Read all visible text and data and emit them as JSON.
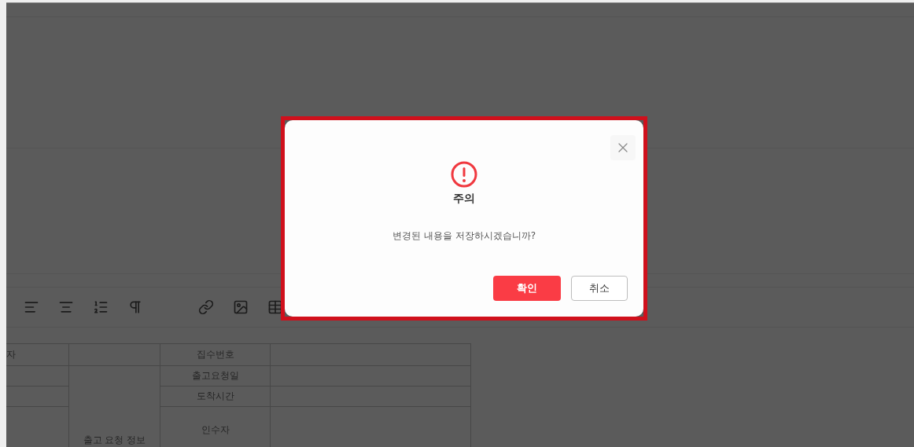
{
  "editor_toolbar": {
    "tools": [
      {
        "kind": "align-left"
      },
      {
        "kind": "align-center"
      },
      {
        "kind": "list"
      },
      {
        "kind": "paragraph"
      },
      {
        "kind": "link"
      },
      {
        "kind": "image"
      },
      {
        "kind": "table"
      }
    ]
  },
  "document_table": {
    "column_1": [
      "자"
    ],
    "section_label": "출고 요청 정보",
    "fields": [
      "집수번호",
      "출고요청일",
      "도착시간",
      "인수자"
    ]
  },
  "dialog": {
    "title": "주의",
    "message": "변경된 내용을 저장하시겠습니까?",
    "buttons": [
      {
        "label": "확인",
        "kind": "primary"
      },
      {
        "label": "취소",
        "kind": "secondary"
      }
    ]
  }
}
